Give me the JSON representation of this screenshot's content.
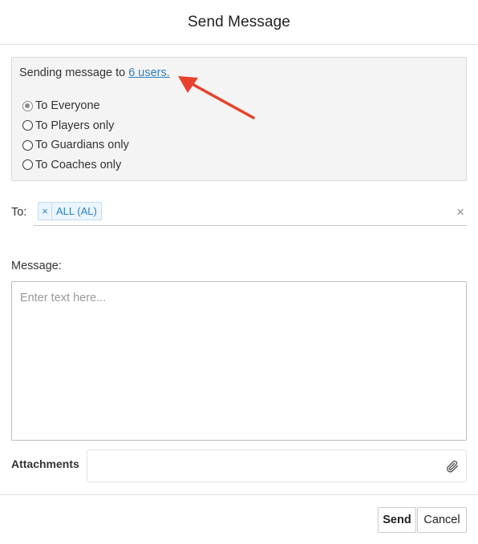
{
  "dialog": {
    "title": "Send Message"
  },
  "recipients": {
    "sending_prefix": "Sending message to",
    "users_link": "6 users.",
    "options": [
      {
        "label": "To Everyone",
        "checked": true
      },
      {
        "label": "To Players only",
        "checked": false
      },
      {
        "label": "To Guardians only",
        "checked": false
      },
      {
        "label": "To Coaches only",
        "checked": false
      }
    ]
  },
  "to": {
    "label": "To:",
    "token_remove": "×",
    "token_label": "ALL (AL)",
    "clear_all": "×"
  },
  "message": {
    "label": "Message:",
    "placeholder": "Enter text here...",
    "value": ""
  },
  "attachments": {
    "label": "Attachments",
    "icon": "paperclip-icon"
  },
  "footer": {
    "send_label": "Send",
    "cancel_label": "Cancel"
  },
  "colors": {
    "link": "#2e7fbf",
    "annotation_arrow": "#e8412c",
    "token_bg": "#ebf5fd"
  }
}
